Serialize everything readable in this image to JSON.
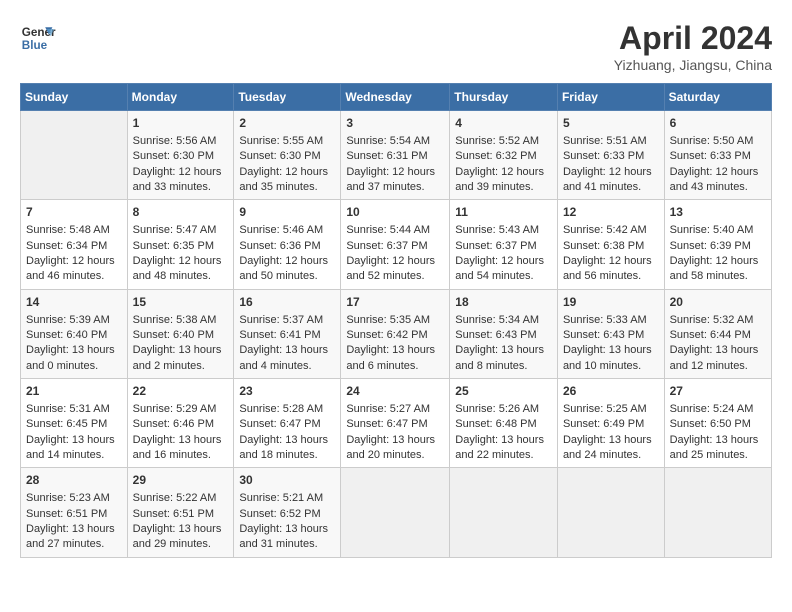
{
  "header": {
    "logo_line1": "General",
    "logo_line2": "Blue",
    "month": "April 2024",
    "location": "Yizhuang, Jiangsu, China"
  },
  "days_of_week": [
    "Sunday",
    "Monday",
    "Tuesday",
    "Wednesday",
    "Thursday",
    "Friday",
    "Saturday"
  ],
  "weeks": [
    [
      {
        "day": "",
        "empty": true
      },
      {
        "day": "1",
        "sunrise": "5:56 AM",
        "sunset": "6:30 PM",
        "daylight": "12 hours and 33 minutes."
      },
      {
        "day": "2",
        "sunrise": "5:55 AM",
        "sunset": "6:30 PM",
        "daylight": "12 hours and 35 minutes."
      },
      {
        "day": "3",
        "sunrise": "5:54 AM",
        "sunset": "6:31 PM",
        "daylight": "12 hours and 37 minutes."
      },
      {
        "day": "4",
        "sunrise": "5:52 AM",
        "sunset": "6:32 PM",
        "daylight": "12 hours and 39 minutes."
      },
      {
        "day": "5",
        "sunrise": "5:51 AM",
        "sunset": "6:33 PM",
        "daylight": "12 hours and 41 minutes."
      },
      {
        "day": "6",
        "sunrise": "5:50 AM",
        "sunset": "6:33 PM",
        "daylight": "12 hours and 43 minutes."
      }
    ],
    [
      {
        "day": "7",
        "sunrise": "5:48 AM",
        "sunset": "6:34 PM",
        "daylight": "12 hours and 46 minutes."
      },
      {
        "day": "8",
        "sunrise": "5:47 AM",
        "sunset": "6:35 PM",
        "daylight": "12 hours and 48 minutes."
      },
      {
        "day": "9",
        "sunrise": "5:46 AM",
        "sunset": "6:36 PM",
        "daylight": "12 hours and 50 minutes."
      },
      {
        "day": "10",
        "sunrise": "5:44 AM",
        "sunset": "6:37 PM",
        "daylight": "12 hours and 52 minutes."
      },
      {
        "day": "11",
        "sunrise": "5:43 AM",
        "sunset": "6:37 PM",
        "daylight": "12 hours and 54 minutes."
      },
      {
        "day": "12",
        "sunrise": "5:42 AM",
        "sunset": "6:38 PM",
        "daylight": "12 hours and 56 minutes."
      },
      {
        "day": "13",
        "sunrise": "5:40 AM",
        "sunset": "6:39 PM",
        "daylight": "12 hours and 58 minutes."
      }
    ],
    [
      {
        "day": "14",
        "sunrise": "5:39 AM",
        "sunset": "6:40 PM",
        "daylight": "13 hours and 0 minutes."
      },
      {
        "day": "15",
        "sunrise": "5:38 AM",
        "sunset": "6:40 PM",
        "daylight": "13 hours and 2 minutes."
      },
      {
        "day": "16",
        "sunrise": "5:37 AM",
        "sunset": "6:41 PM",
        "daylight": "13 hours and 4 minutes."
      },
      {
        "day": "17",
        "sunrise": "5:35 AM",
        "sunset": "6:42 PM",
        "daylight": "13 hours and 6 minutes."
      },
      {
        "day": "18",
        "sunrise": "5:34 AM",
        "sunset": "6:43 PM",
        "daylight": "13 hours and 8 minutes."
      },
      {
        "day": "19",
        "sunrise": "5:33 AM",
        "sunset": "6:43 PM",
        "daylight": "13 hours and 10 minutes."
      },
      {
        "day": "20",
        "sunrise": "5:32 AM",
        "sunset": "6:44 PM",
        "daylight": "13 hours and 12 minutes."
      }
    ],
    [
      {
        "day": "21",
        "sunrise": "5:31 AM",
        "sunset": "6:45 PM",
        "daylight": "13 hours and 14 minutes."
      },
      {
        "day": "22",
        "sunrise": "5:29 AM",
        "sunset": "6:46 PM",
        "daylight": "13 hours and 16 minutes."
      },
      {
        "day": "23",
        "sunrise": "5:28 AM",
        "sunset": "6:47 PM",
        "daylight": "13 hours and 18 minutes."
      },
      {
        "day": "24",
        "sunrise": "5:27 AM",
        "sunset": "6:47 PM",
        "daylight": "13 hours and 20 minutes."
      },
      {
        "day": "25",
        "sunrise": "5:26 AM",
        "sunset": "6:48 PM",
        "daylight": "13 hours and 22 minutes."
      },
      {
        "day": "26",
        "sunrise": "5:25 AM",
        "sunset": "6:49 PM",
        "daylight": "13 hours and 24 minutes."
      },
      {
        "day": "27",
        "sunrise": "5:24 AM",
        "sunset": "6:50 PM",
        "daylight": "13 hours and 25 minutes."
      }
    ],
    [
      {
        "day": "28",
        "sunrise": "5:23 AM",
        "sunset": "6:51 PM",
        "daylight": "13 hours and 27 minutes."
      },
      {
        "day": "29",
        "sunrise": "5:22 AM",
        "sunset": "6:51 PM",
        "daylight": "13 hours and 29 minutes."
      },
      {
        "day": "30",
        "sunrise": "5:21 AM",
        "sunset": "6:52 PM",
        "daylight": "13 hours and 31 minutes."
      },
      {
        "day": "",
        "empty": true
      },
      {
        "day": "",
        "empty": true
      },
      {
        "day": "",
        "empty": true
      },
      {
        "day": "",
        "empty": true
      }
    ]
  ]
}
